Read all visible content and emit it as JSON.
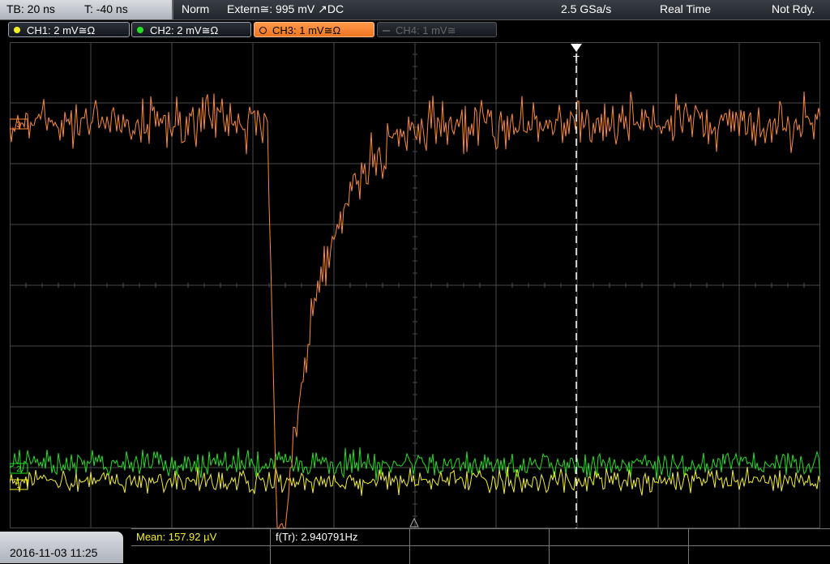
{
  "topbar": {
    "timebase": "TB: 20 ns",
    "trigger_time": "T: -40 ns",
    "mode": "Norm",
    "trigger_source": "Extern≅: 995 mV ↗DC",
    "sample_rate": "2.5 GSa/s",
    "acq_mode": "Real Time",
    "status": "Not Rdy."
  },
  "channels": [
    {
      "label": "CH1: 2 mV≅Ω",
      "color": "#f3f024",
      "state": "on"
    },
    {
      "label": "CH2: 2 mV≅Ω",
      "color": "#22e022",
      "state": "on"
    },
    {
      "label": "CH3: 1 mV≅Ω",
      "color": "#ff8a33",
      "state": "active"
    },
    {
      "label": "CH4: 1 mV≅",
      "color": "#555555",
      "state": "off"
    }
  ],
  "markers": {
    "trigger": "T",
    "ch3_ref": "3",
    "ch2_ref": "2",
    "ch1_ref": "1"
  },
  "bottom": {
    "datetime": "2016-11-03  11:25",
    "mean": "Mean: 157.92 µV",
    "freq": "f(Tr): 2.940791Hz"
  },
  "colors": {
    "ch1": "#f3f024",
    "ch2": "#22e022",
    "ch3": "#ff8a33",
    "grid": "#4a4a4a"
  }
}
